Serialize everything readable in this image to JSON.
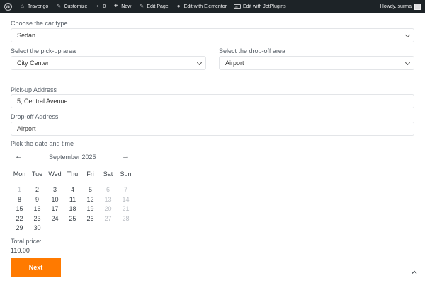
{
  "adminbar": {
    "site_name": "Travengo",
    "customize": "Customize",
    "comments_count": "0",
    "new_label": "New",
    "edit_page": "Edit Page",
    "edit_elementor": "Edit with Elementor",
    "edit_jetplugins": "Edit with JetPlugins",
    "jet_icon_text": "JET",
    "howdy": "Howdy, surma"
  },
  "form": {
    "car_type_label": "Choose the car type",
    "car_type_value": "Sedan",
    "pickup_area_label": "Select the pick-up area",
    "pickup_area_value": "City Center",
    "dropoff_area_label": "Select the drop-off area",
    "dropoff_area_value": "Airport",
    "pickup_address_label": "Pick-up Address",
    "pickup_address_value": "5, Central Avenue",
    "dropoff_address_label": "Drop-off Address",
    "dropoff_address_value": "Airport",
    "datetime_label": "Pick the date and time",
    "total_label": "Total price:",
    "total_value": "110.00",
    "next_label": "Next"
  },
  "calendar": {
    "month": "September 2025",
    "prev_symbol": "←",
    "next_symbol": "→",
    "weekdays": [
      "Mon",
      "Tue",
      "Wed",
      "Thu",
      "Fri",
      "Sat",
      "Sun"
    ],
    "days": [
      {
        "d": "1",
        "off": true
      },
      {
        "d": "2",
        "off": false
      },
      {
        "d": "3",
        "off": false
      },
      {
        "d": "4",
        "off": false
      },
      {
        "d": "5",
        "off": false
      },
      {
        "d": "6",
        "off": true
      },
      {
        "d": "7",
        "off": true
      },
      {
        "d": "8",
        "off": false
      },
      {
        "d": "9",
        "off": false
      },
      {
        "d": "10",
        "off": false
      },
      {
        "d": "11",
        "off": false
      },
      {
        "d": "12",
        "off": false
      },
      {
        "d": "13",
        "off": true
      },
      {
        "d": "14",
        "off": true
      },
      {
        "d": "15",
        "off": false
      },
      {
        "d": "16",
        "off": false
      },
      {
        "d": "17",
        "off": false
      },
      {
        "d": "18",
        "off": false
      },
      {
        "d": "19",
        "off": false
      },
      {
        "d": "20",
        "off": true
      },
      {
        "d": "21",
        "off": true
      },
      {
        "d": "22",
        "off": false
      },
      {
        "d": "23",
        "off": false
      },
      {
        "d": "24",
        "off": false
      },
      {
        "d": "25",
        "off": false
      },
      {
        "d": "26",
        "off": false
      },
      {
        "d": "27",
        "off": true
      },
      {
        "d": "28",
        "off": true
      },
      {
        "d": "29",
        "off": false
      },
      {
        "d": "30",
        "off": false
      }
    ]
  },
  "colors": {
    "adminbar_bg": "#1d2327",
    "accent": "#ff7a00",
    "disabled_day": "#b9bdc3"
  }
}
